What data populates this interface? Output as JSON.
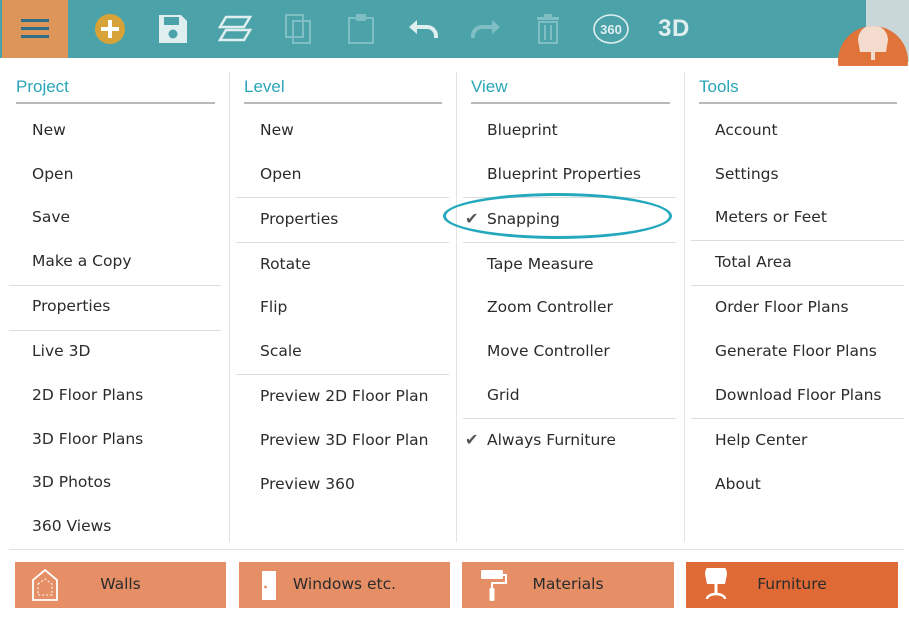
{
  "toolbar": {
    "icons": [
      "menu-icon",
      "add-icon",
      "save-icon",
      "layers-icon",
      "copy-icon",
      "paste-icon",
      "undo-icon",
      "redo-icon",
      "delete-icon",
      "360-icon",
      "3d-icon"
    ],
    "label_360": "360",
    "label_3d": "3D"
  },
  "menu": {
    "project": {
      "title": "Project",
      "items": [
        "New",
        "Open",
        "Save",
        "Make a Copy",
        "Properties",
        "Live 3D",
        "2D Floor Plans",
        "3D Floor Plans",
        "3D Photos",
        "360 Views"
      ]
    },
    "level": {
      "title": "Level",
      "items": [
        "New",
        "Open",
        "Properties",
        "Rotate",
        "Flip",
        "Scale",
        "Preview 2D Floor Plan",
        "Preview 3D Floor Plan",
        "Preview 360"
      ]
    },
    "view": {
      "title": "View",
      "items": [
        "Blueprint",
        "Blueprint Properties",
        "Snapping",
        "Tape Measure",
        "Zoom Controller",
        "Move Controller",
        "Grid",
        "Always Furniture"
      ],
      "checked": [
        "Snapping",
        "Always Furniture"
      ],
      "check_mark": "✔"
    },
    "tools": {
      "title": "Tools",
      "items": [
        "Account",
        "Settings",
        "Meters or Feet",
        "Total Area",
        "Order Floor Plans",
        "Generate Floor Plans",
        "Download Floor Plans",
        "Help Center",
        "About"
      ]
    }
  },
  "categories": [
    {
      "label": "Walls",
      "icon": "house-icon"
    },
    {
      "label": "Windows etc.",
      "icon": "door-icon"
    },
    {
      "label": "Materials",
      "icon": "paint-roller-icon"
    },
    {
      "label": "Furniture",
      "icon": "chair-icon",
      "active": true
    }
  ],
  "colors": {
    "toolbar": "#4ba3a9",
    "menu_button": "#dd955a",
    "accent": "#2aa6b8",
    "category": "#e68f66",
    "category_active": "#e06a35"
  }
}
